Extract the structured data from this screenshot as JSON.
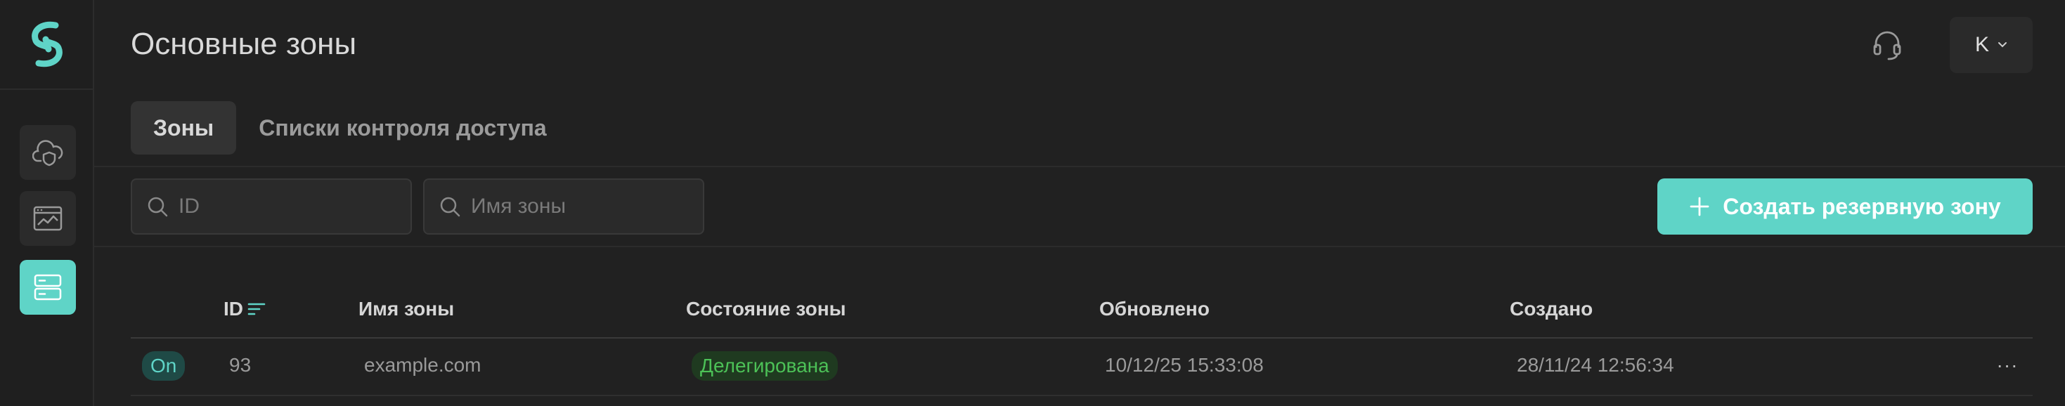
{
  "header": {
    "title": "Основные зоны",
    "user_initial": "K"
  },
  "tabs": [
    {
      "label": "Зоны",
      "active": true
    },
    {
      "label": "Списки контроля доступа",
      "active": false
    }
  ],
  "filters": {
    "id_placeholder": "ID",
    "name_placeholder": "Имя зоны"
  },
  "actions": {
    "create_label": "Создать резервную зону"
  },
  "table": {
    "columns": [
      "ID",
      "Имя зоны",
      "Состояние зоны",
      "Обновлено",
      "Создано"
    ],
    "rows": [
      {
        "toggle": "On",
        "id": "93",
        "name": "example.com",
        "status": "Делегирована",
        "updated": "10/12/25 15:33:08",
        "created": "28/11/24 12:56:34",
        "more": "···"
      }
    ]
  },
  "colors": {
    "accent": "#5fd4c7",
    "status_ok": "#4cc157",
    "background": "#212121"
  },
  "icons": [
    "logo-icon",
    "cloud-shield-icon",
    "browser-chart-icon",
    "server-icon",
    "headset-icon",
    "chevron-down-icon",
    "search-icon",
    "plus-icon",
    "sort-icon",
    "more-icon"
  ]
}
